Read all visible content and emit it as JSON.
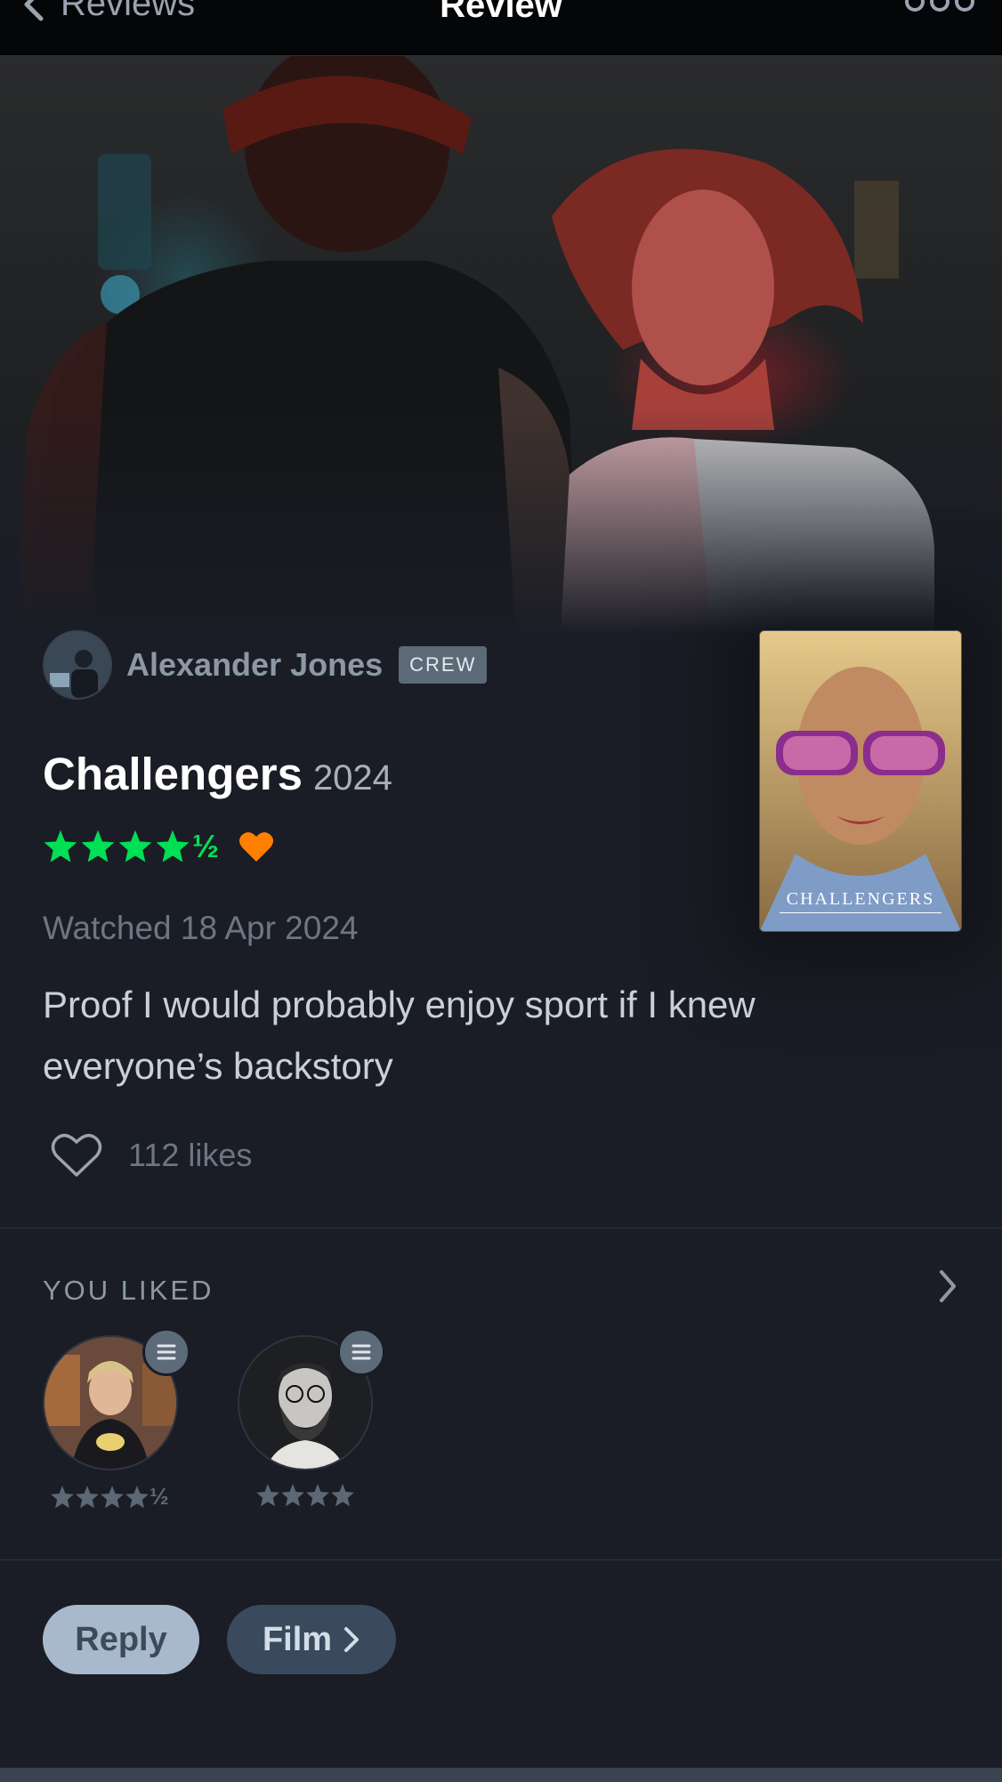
{
  "nav": {
    "back_label": "Reviews",
    "title": "Review"
  },
  "review": {
    "author": "Alexander Jones",
    "badge": "CREW",
    "film_title": "Challengers",
    "year": "2024",
    "rating": 4.5,
    "rating_half_glyph": "½",
    "liked": true,
    "watched": "Watched 18 Apr 2024",
    "text": "Proof I would probably enjoy sport if I knew everyone’s backstory",
    "likes": "112 likes"
  },
  "poster": {
    "title": "CHALLENGERS"
  },
  "you_liked": {
    "heading": "YOU LIKED",
    "items": [
      {
        "rating": 4.5,
        "half_glyph": "½"
      },
      {
        "rating": 4
      }
    ]
  },
  "actions": {
    "reply_label": "Reply",
    "film_label": "Film"
  },
  "colors": {
    "star_green": "#00e054",
    "heart_orange": "#ff8000",
    "background": "#1a1d25"
  },
  "icons": {
    "back": "chevron-left-icon",
    "more": "more-dots-icon",
    "heart": "heart-icon",
    "list": "list-icon",
    "next": "chevron-right-icon"
  }
}
